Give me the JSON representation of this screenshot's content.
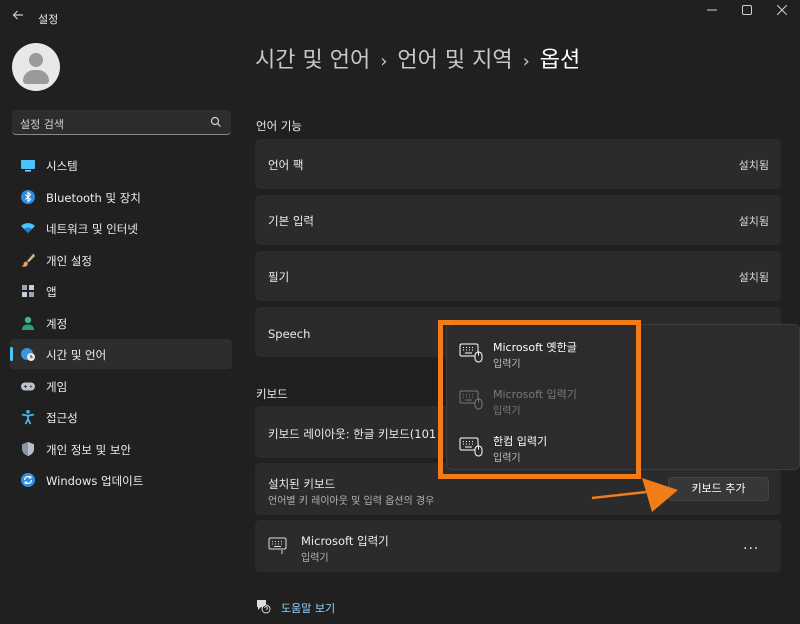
{
  "window": {
    "title": "설정"
  },
  "sidebar": {
    "search_placeholder": "설정 검색",
    "items": [
      {
        "label": "시스템",
        "icon": "monitor-icon"
      },
      {
        "label": "Bluetooth 및 장치",
        "icon": "bluetooth-icon"
      },
      {
        "label": "네트워크 및 인터넷",
        "icon": "wifi-icon"
      },
      {
        "label": "개인 설정",
        "icon": "brush-icon"
      },
      {
        "label": "앱",
        "icon": "apps-icon"
      },
      {
        "label": "계정",
        "icon": "person-icon"
      },
      {
        "label": "시간 및 언어",
        "icon": "globe-clock-icon",
        "active": true
      },
      {
        "label": "게임",
        "icon": "gamepad-icon"
      },
      {
        "label": "접근성",
        "icon": "accessibility-icon"
      },
      {
        "label": "개인 정보 및 보안",
        "icon": "shield-icon"
      },
      {
        "label": "Windows 업데이트",
        "icon": "update-icon"
      }
    ]
  },
  "breadcrumb": {
    "part1": "시간 및 언어",
    "part2": "언어 및 지역",
    "current": "옵션"
  },
  "language_features": {
    "heading": "언어 기능",
    "items": [
      {
        "label": "언어 팩",
        "status": "설치됨"
      },
      {
        "label": "기본 입력",
        "status": "설치됨"
      },
      {
        "label": "필기",
        "status": "설치됨"
      },
      {
        "label": "Speech",
        "status": ""
      }
    ]
  },
  "keyboard": {
    "heading": "키보드",
    "layout_label": "키보드 레이아웃: 한글 키보드(101",
    "installed_title": "설치된 키보드",
    "installed_desc": "언어별 키 레이아웃 및 입력 옵션의 경우",
    "add_button": "키보드 추가",
    "installed_item_title": "Microsoft 입력기",
    "installed_item_sub": "입력기",
    "more": "..."
  },
  "popup": {
    "items": [
      {
        "title": "Microsoft 옛한글",
        "sub": "입력기",
        "disabled": false
      },
      {
        "title": "Microsoft 입력기",
        "sub": "입력기",
        "disabled": true
      },
      {
        "title": "한컴 입력기",
        "sub": "입력기",
        "disabled": false
      }
    ]
  },
  "help": {
    "label": "도움말 보기"
  },
  "colors": {
    "accent": "#4cc2ff",
    "annotation": "#f07d19",
    "background": "#202020",
    "card": "#2b2b2b"
  }
}
